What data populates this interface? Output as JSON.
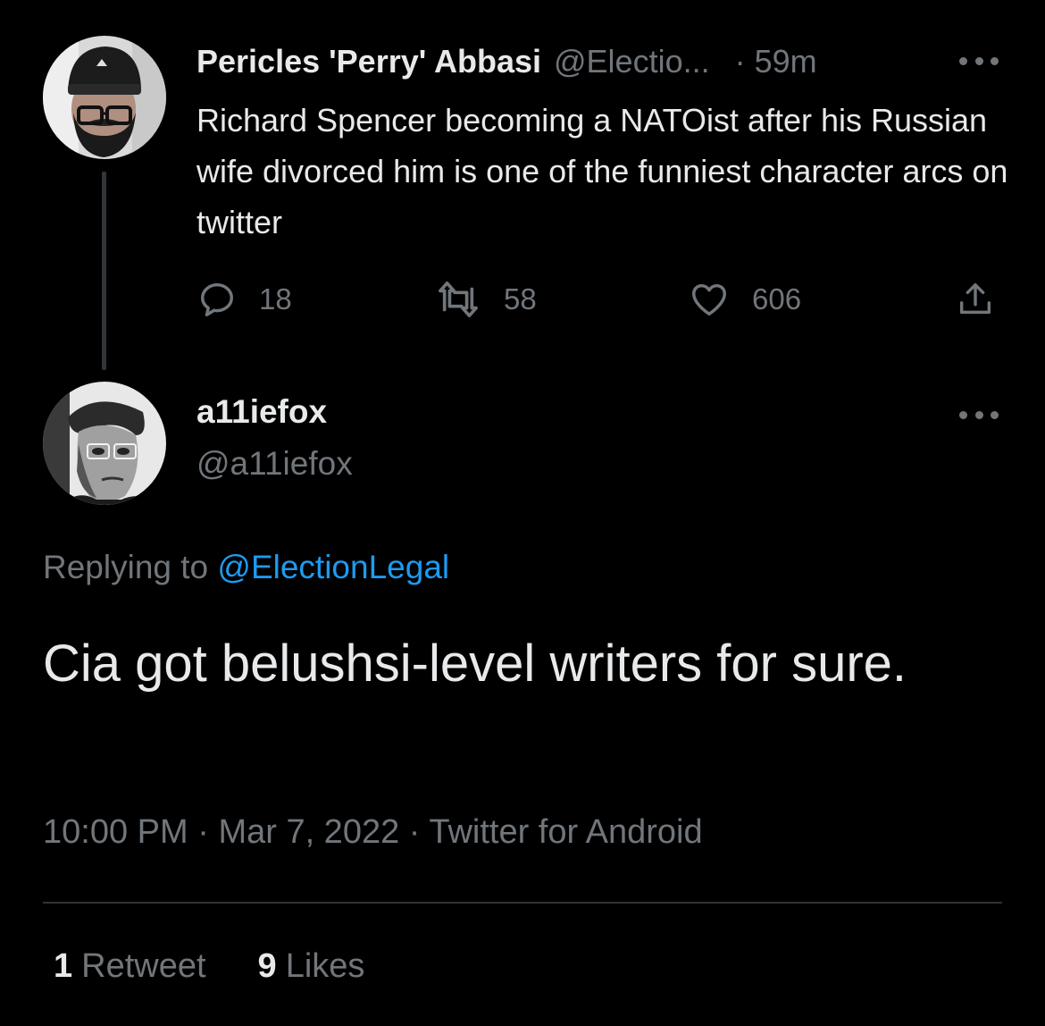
{
  "parent_tweet": {
    "display_name": "Pericles 'Perry' Abbasi",
    "handle": "@Electio...",
    "separator": "·",
    "time": "59m",
    "body": "Richard Spencer becoming a NATOist after his Russian wife divorced him is one of the funniest character arcs on twitter",
    "reply_count": "18",
    "retweet_count": "58",
    "like_count": "606",
    "avatar_icon": "bearded-man-beanie-avatar"
  },
  "main_tweet": {
    "display_name": "a11iefox",
    "handle": "@a11iefox",
    "replying_prefix": "Replying to ",
    "replying_to": "@ElectionLegal",
    "body": "Cia got belushsi-level writers for sure.",
    "time": "10:00 PM",
    "separator": " · ",
    "date": "Mar 7, 2022",
    "source": "Twitter for Android",
    "retweets_num": "1",
    "retweets_label": "Retweet",
    "likes_num": "9",
    "likes_label": "Likes",
    "avatar_icon": "grayscale-man-avatar"
  },
  "colors": {
    "background": "#000000",
    "text_primary": "#e7e9ea",
    "text_secondary": "#71767b",
    "link": "#1d9bf0",
    "divider": "#2f3336"
  }
}
